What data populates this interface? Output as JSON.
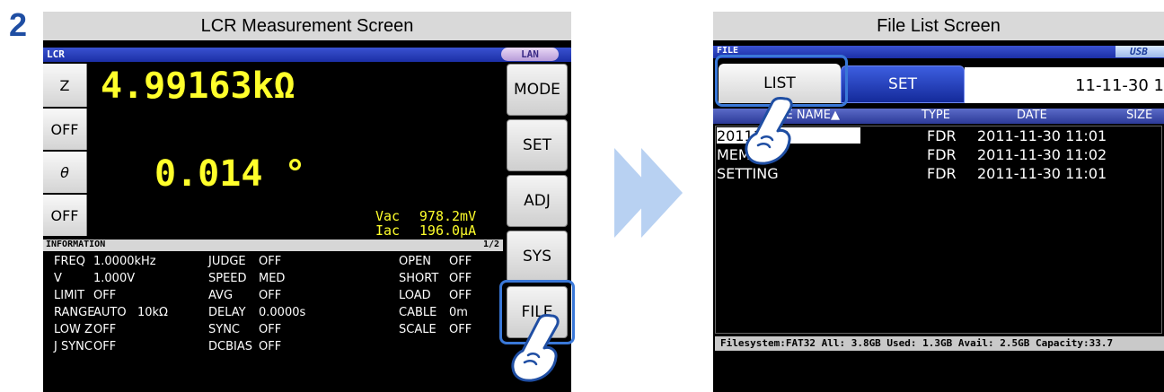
{
  "step_number": "2",
  "left_panel": {
    "caption": "LCR Measurement Screen",
    "topbar": {
      "title": "LCR",
      "lan_badge": "LAN"
    },
    "left_buttons": [
      "Z",
      "OFF",
      "θ",
      "OFF"
    ],
    "readout1": "4.99163kΩ",
    "readout2": "0.014 °",
    "monitor": {
      "vac_label": "Vac",
      "vac_value": "978.2mV",
      "iac_label": "Iac",
      "iac_value": "196.0μA"
    },
    "info_header": {
      "title": "INFORMATION",
      "page": "1/2"
    },
    "info_rows": [
      {
        "c1": "FREQ",
        "c2": "1.0000kHz",
        "c3": "JUDGE",
        "c4": "OFF",
        "c5": "OPEN",
        "c6": "OFF"
      },
      {
        "c1": "V",
        "c2": "1.000V",
        "c3": "SPEED",
        "c4": "MED",
        "c5": "SHORT",
        "c6": "OFF"
      },
      {
        "c1": "LIMIT",
        "c2": "OFF",
        "c3": "AVG",
        "c4": "OFF",
        "c5": "LOAD",
        "c6": "OFF"
      },
      {
        "c1": "RANGE",
        "c2": "AUTO   10kΩ",
        "c3": "DELAY",
        "c4": "0.0000s",
        "c5": "CABLE",
        "c6": "0m"
      },
      {
        "c1": "LOW Z",
        "c2": "OFF",
        "c3": "SYNC",
        "c4": "OFF",
        "c5": "SCALE",
        "c6": "OFF"
      },
      {
        "c1": "J SYNC",
        "c2": "OFF",
        "c3": "DCBIAS",
        "c4": "OFF",
        "c5": "",
        "c6": ""
      }
    ],
    "side_buttons": [
      "MODE",
      "SET",
      "ADJ",
      "SYS",
      "FILE"
    ]
  },
  "right_panel": {
    "caption": "File List Screen",
    "topbar": {
      "title": "FILE",
      "usb_badge": "USB"
    },
    "tabs": {
      "list": "LIST",
      "set": "SET"
    },
    "date": "11-11-30 1",
    "columns": [
      "FILE NAME▲",
      "TYPE",
      "DATE",
      "SIZE"
    ],
    "rows": [
      {
        "name": "20111130",
        "type": "FDR",
        "date": "2011-11-30 11:01"
      },
      {
        "name": "MEMORY",
        "type": "FDR",
        "date": "2011-11-30 11:02"
      },
      {
        "name": "SETTING",
        "type": "FDR",
        "date": "2011-11-30 11:01"
      }
    ],
    "status_bar": "Filesystem:FAT32 All: 3.8GB Used: 1.3GB Avail: 2.5GB Capacity:33.7"
  },
  "colors": {
    "screen_bg": "#000000",
    "readout": "#ffff2b",
    "highlight": "#3a78d8",
    "arrow": "#b8d1f2"
  }
}
